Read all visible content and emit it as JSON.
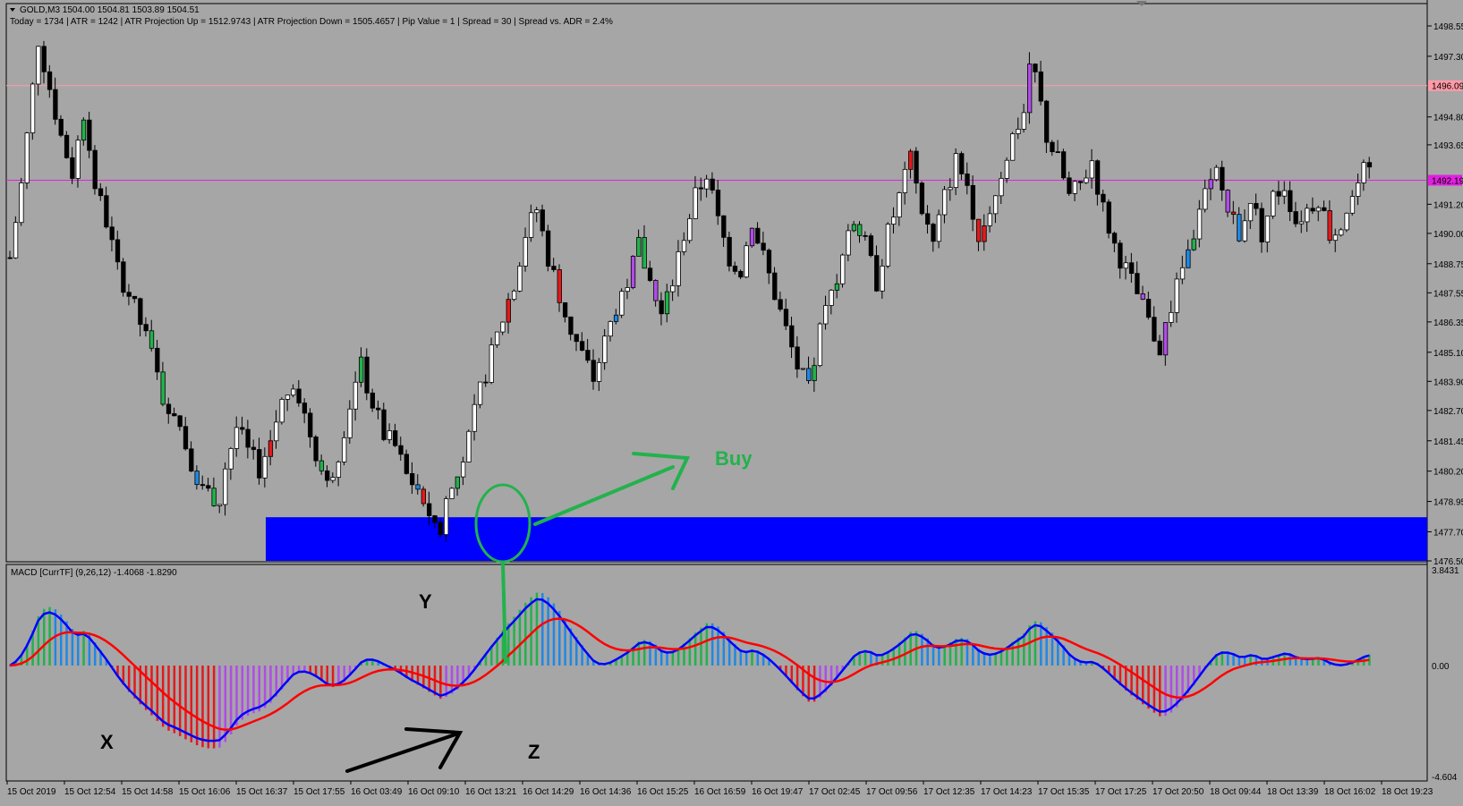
{
  "window": {
    "symbol_line": "GOLD,M3  1504.00 1504.81 1503.89 1504.51",
    "info_line": "Today = 1734   |   ATR = 1242   |   ATR Projection Up = 1512.9743   |   ATR Projection Down = 1505.4657   |   Pip Value = 1   |   Spread = 30   |   Spread vs. ADR = 2.4%"
  },
  "price_axis": {
    "ticks": [
      "1498.55",
      "1497.30",
      "1494.80",
      "1493.65",
      "1491.20",
      "1490.00",
      "1488.75",
      "1487.55",
      "1486.35",
      "1485.10",
      "1483.90",
      "1482.70",
      "1481.45",
      "1480.20",
      "1478.95",
      "1477.70",
      "1476.50"
    ],
    "tick_values": [
      1498.55,
      1497.3,
      1494.8,
      1493.65,
      1491.2,
      1490.0,
      1488.75,
      1487.55,
      1486.35,
      1485.1,
      1483.9,
      1482.7,
      1481.45,
      1480.2,
      1478.95,
      1477.7,
      1476.5
    ],
    "levels": [
      {
        "label": "1496.09",
        "value": 1496.09,
        "color": "#ff9aa8"
      },
      {
        "label": "1492.19",
        "value": 1492.19,
        "color": "#e020e0"
      }
    ]
  },
  "macd_panel": {
    "title": "MACD [CurrTF] (9,26,12) -1.4068 -1.8290",
    "axis_top": "3.8431",
    "axis_zero": "0.00",
    "axis_bottom": "-4.604"
  },
  "time_axis": {
    "labels": [
      "15 Oct 2019",
      "15 Oct 12:54",
      "15 Oct 14:58",
      "15 Oct 16:06",
      "15 Oct 16:37",
      "15 Oct 17:55",
      "16 Oct 03:49",
      "16 Oct 09:10",
      "16 Oct 13:21",
      "16 Oct 14:29",
      "16 Oct 14:36",
      "16 Oct 15:25",
      "16 Oct 16:59",
      "16 Oct 19:47",
      "17 Oct 02:45",
      "17 Oct 09:56",
      "17 Oct 12:35",
      "17 Oct 14:23",
      "17 Oct 15:35",
      "17 Oct 17:25",
      "17 Oct 20:50",
      "18 Oct 09:44",
      "18 Oct 13:39",
      "18 Oct 16:02",
      "18 Oct 19:23"
    ]
  },
  "annotations": {
    "buy": "Buy",
    "x": "X",
    "y": "Y",
    "z": "Z"
  },
  "colors": {
    "background": "#a6a6a6",
    "demand_zone": "#0000ff",
    "annotation_green": "#22b24c",
    "macd_line": "#0000ff",
    "signal_line": "#ff0000"
  },
  "chart_data": {
    "type": "candlestick",
    "symbol": "GOLD",
    "timeframe": "M3",
    "ylim": [
      1476.5,
      1498.55
    ],
    "demand_zone": {
      "from_label": "15 Oct 16:37",
      "price_top": 1478.3,
      "price_bottom": 1476.5
    },
    "close_path": [
      [
        0,
        1489.0
      ],
      [
        2,
        1492.0
      ],
      [
        4,
        1496.0
      ],
      [
        5,
        1498.0
      ],
      [
        7,
        1496.0
      ],
      [
        9,
        1494.0
      ],
      [
        11,
        1492.5
      ],
      [
        13,
        1495.0
      ],
      [
        15,
        1492.0
      ],
      [
        17,
        1490.5
      ],
      [
        19,
        1488.5
      ],
      [
        21,
        1487.5
      ],
      [
        23,
        1486.3
      ],
      [
        25,
        1485.0
      ],
      [
        27,
        1483.2
      ],
      [
        29,
        1482.8
      ],
      [
        31,
        1481.3
      ],
      [
        33,
        1480.0
      ],
      [
        35,
        1479.3
      ],
      [
        37,
        1479.0
      ],
      [
        38,
        1480.4
      ],
      [
        40,
        1482.0
      ],
      [
        42,
        1481.0
      ],
      [
        44,
        1480.3
      ],
      [
        46,
        1481.5
      ],
      [
        48,
        1483.0
      ],
      [
        50,
        1484.0
      ],
      [
        52,
        1482.5
      ],
      [
        54,
        1481.0
      ],
      [
        56,
        1479.6
      ],
      [
        58,
        1481.0
      ],
      [
        60,
        1483.0
      ],
      [
        62,
        1484.5
      ],
      [
        64,
        1483.0
      ],
      [
        66,
        1481.7
      ],
      [
        68,
        1481.2
      ],
      [
        70,
        1480.0
      ],
      [
        72,
        1479.5
      ],
      [
        74,
        1478.5
      ],
      [
        76,
        1477.6
      ],
      [
        77,
        1479.0
      ],
      [
        79,
        1480.0
      ],
      [
        81,
        1481.5
      ],
      [
        83,
        1483.5
      ],
      [
        85,
        1485.0
      ],
      [
        87,
        1486.5
      ],
      [
        89,
        1488.0
      ],
      [
        91,
        1490.0
      ],
      [
        93,
        1491.0
      ],
      [
        95,
        1489.0
      ],
      [
        97,
        1487.5
      ],
      [
        99,
        1486.0
      ],
      [
        101,
        1485.0
      ],
      [
        103,
        1484.0
      ],
      [
        105,
        1485.5
      ],
      [
        107,
        1487.0
      ],
      [
        109,
        1488.0
      ],
      [
        111,
        1489.5
      ],
      [
        113,
        1488.0
      ],
      [
        115,
        1486.5
      ],
      [
        117,
        1488.0
      ],
      [
        119,
        1490.0
      ],
      [
        121,
        1491.5
      ],
      [
        123,
        1492.5
      ],
      [
        125,
        1490.5
      ],
      [
        127,
        1489.0
      ],
      [
        129,
        1488.5
      ],
      [
        131,
        1490.5
      ],
      [
        133,
        1489.0
      ],
      [
        135,
        1487.5
      ],
      [
        137,
        1486.0
      ],
      [
        139,
        1484.5
      ],
      [
        141,
        1483.5
      ],
      [
        143,
        1486.0
      ],
      [
        145,
        1487.5
      ],
      [
        147,
        1489.0
      ],
      [
        149,
        1490.5
      ],
      [
        151,
        1489.5
      ],
      [
        153,
        1488.0
      ],
      [
        155,
        1490.0
      ],
      [
        157,
        1491.5
      ],
      [
        159,
        1493.0
      ],
      [
        161,
        1491.0
      ],
      [
        163,
        1489.5
      ],
      [
        165,
        1491.5
      ],
      [
        167,
        1493.0
      ],
      [
        169,
        1492.0
      ],
      [
        171,
        1490.0
      ],
      [
        173,
        1491.0
      ],
      [
        175,
        1492.5
      ],
      [
        177,
        1494.0
      ],
      [
        179,
        1495.0
      ],
      [
        180,
        1497.0
      ],
      [
        181,
        1496.5
      ],
      [
        183,
        1494.0
      ],
      [
        185,
        1493.0
      ],
      [
        187,
        1491.5
      ],
      [
        189,
        1492.0
      ],
      [
        191,
        1493.0
      ],
      [
        193,
        1491.0
      ],
      [
        195,
        1489.5
      ],
      [
        197,
        1488.5
      ],
      [
        199,
        1487.5
      ],
      [
        201,
        1486.3
      ],
      [
        203,
        1485.3
      ],
      [
        205,
        1487.0
      ],
      [
        207,
        1488.5
      ],
      [
        209,
        1490.0
      ],
      [
        211,
        1491.5
      ],
      [
        213,
        1492.5
      ],
      [
        215,
        1491.0
      ],
      [
        217,
        1490.0
      ],
      [
        219,
        1491.5
      ],
      [
        221,
        1490.0
      ],
      [
        223,
        1491.5
      ],
      [
        225,
        1492.0
      ],
      [
        227,
        1490.5
      ],
      [
        229,
        1491.0
      ],
      [
        231,
        1491.5
      ],
      [
        233,
        1490.0
      ],
      [
        235,
        1490.5
      ],
      [
        237,
        1491.5
      ],
      [
        239,
        1492.5
      ],
      [
        240,
        1492.3
      ]
    ]
  }
}
